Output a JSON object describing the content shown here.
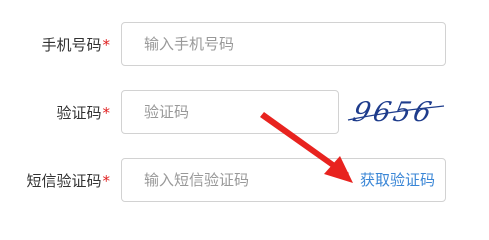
{
  "form": {
    "phone": {
      "label": "手机号码",
      "required_mark": "*",
      "placeholder": "输入手机号码",
      "value": ""
    },
    "captcha": {
      "label": "验证码",
      "required_mark": "*",
      "placeholder": "验证码",
      "value": "",
      "image_text": "9656"
    },
    "sms": {
      "label": "短信验证码",
      "required_mark": "*",
      "placeholder": "输入短信验证码",
      "value": "",
      "get_code_label": "获取验证码"
    }
  },
  "colors": {
    "required": "#e02020",
    "link": "#3a86d6",
    "border": "#d2d2d2",
    "placeholder": "#999999",
    "captcha_ink": "#1e3c8c",
    "arrow": "#e8231f"
  }
}
